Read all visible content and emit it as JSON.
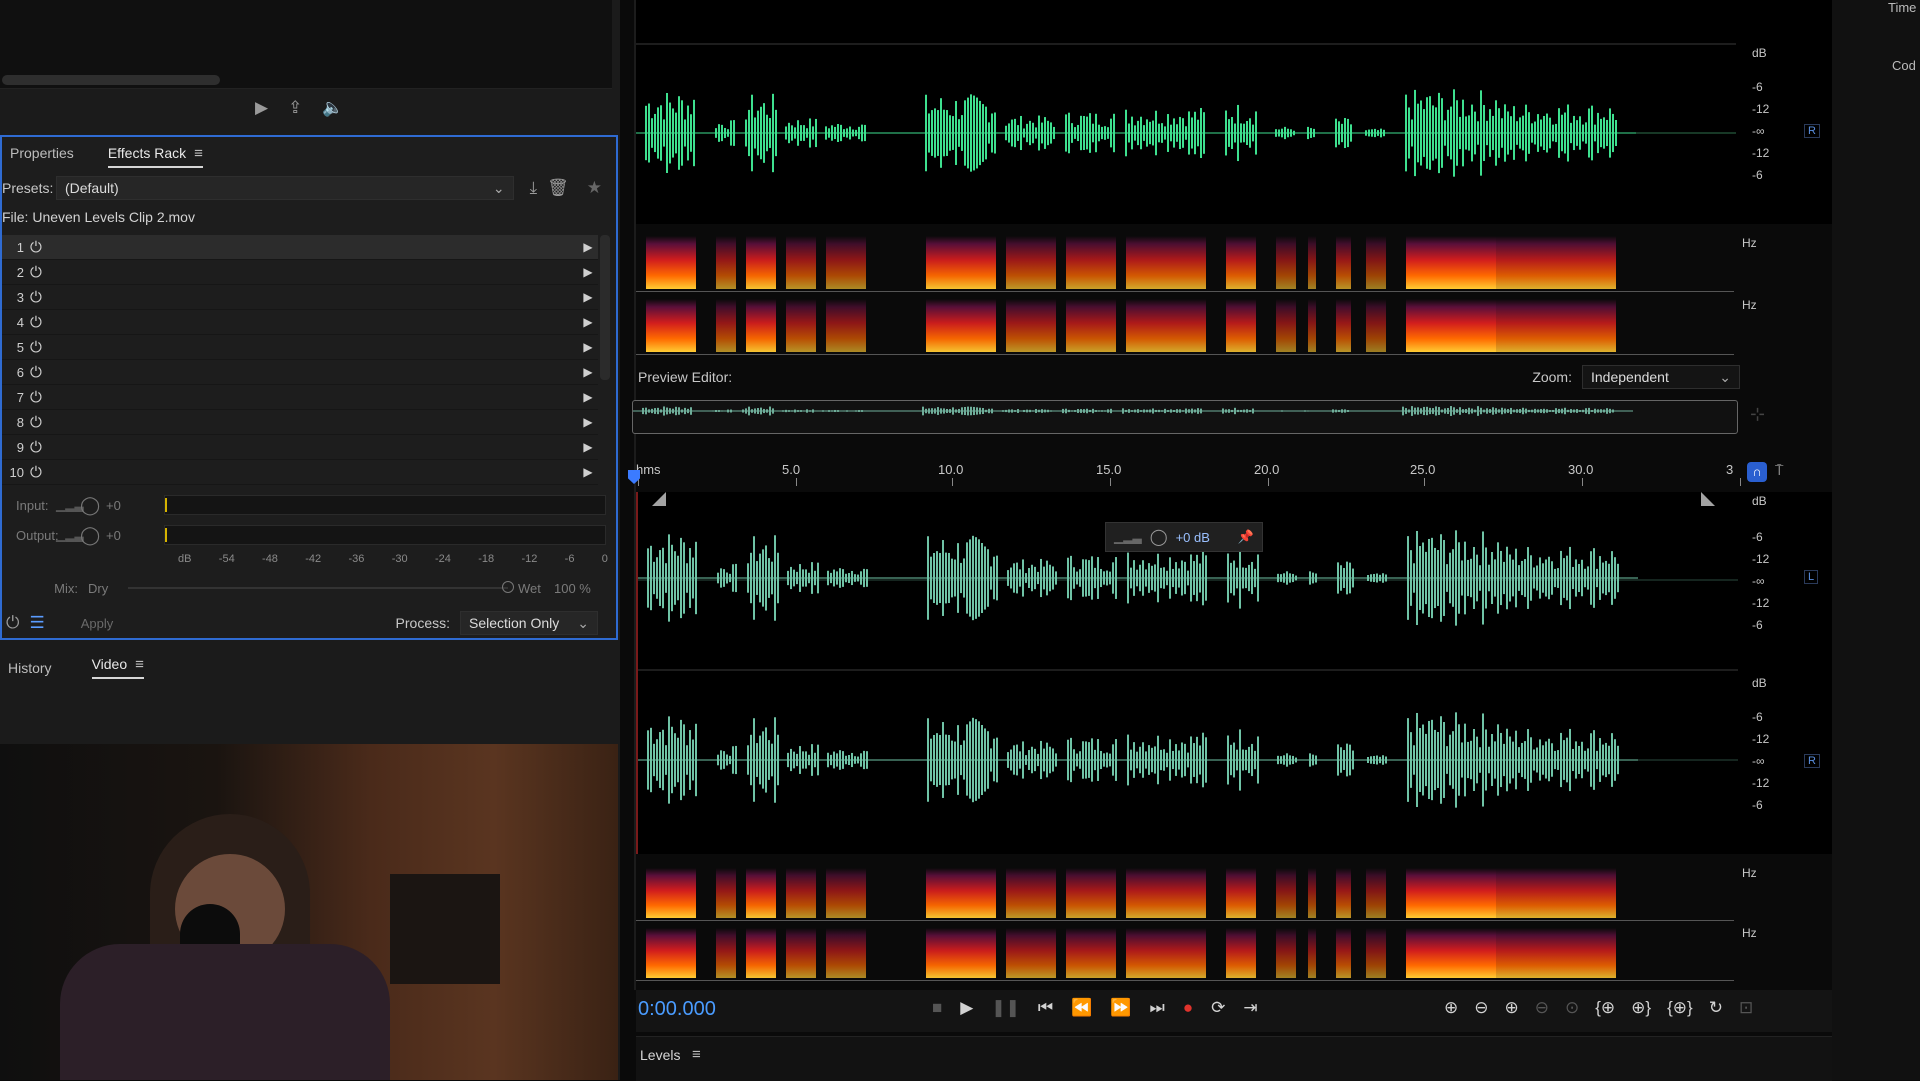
{
  "top_transport": {
    "play": "▶",
    "export": "⇪",
    "volume": "🔈"
  },
  "effects_rack": {
    "tabs": [
      {
        "label": "Properties"
      },
      {
        "label": "Effects Rack"
      }
    ],
    "presets_label": "Presets:",
    "preset_value": "(Default)",
    "file_label": "File: Uneven Levels Clip 2.mov",
    "slots": [
      "1",
      "2",
      "3",
      "4",
      "5",
      "6",
      "7",
      "8",
      "9",
      "10"
    ],
    "input_label": "Input:",
    "input_value": "+0",
    "output_label": "Output:",
    "output_value": "+0",
    "db_ticks": [
      "dB",
      "-54",
      "-48",
      "-42",
      "-36",
      "-30",
      "-24",
      "-18",
      "-12",
      "-6",
      "0"
    ],
    "mix_label": "Mix:",
    "dry_label": "Dry",
    "wet_label": "Wet",
    "wet_value": "100 %",
    "apply_label": "Apply",
    "process_label": "Process:",
    "process_value": "Selection Only"
  },
  "lower_tabs": [
    {
      "label": "History"
    },
    {
      "label": "Video"
    }
  ],
  "editor": {
    "top_db": [
      "dB",
      "-6",
      "-12",
      "-∞",
      "-12",
      "-6"
    ],
    "top_channel": "R",
    "hz_labels": [
      "Hz",
      "Hz"
    ],
    "preview_label": "Preview Editor:",
    "zoom_label": "Zoom:",
    "zoom_value": "Independent",
    "ruler": [
      "hms",
      "5.0",
      "10.0",
      "15.0",
      "20.0",
      "25.0",
      "30.0",
      "3"
    ],
    "popup_db": "+0 dB",
    "lower_db_L": [
      "dB",
      "-6",
      "-12",
      "-∞",
      "-12",
      "-6"
    ],
    "lower_db_R": [
      "dB",
      "-6",
      "-12",
      "-∞",
      "-12",
      "-6"
    ],
    "channel_L": "L",
    "channel_R": "R",
    "hz_labels2": [
      "Hz",
      "Hz"
    ],
    "timecode": "0:00.000"
  },
  "transport_icons": [
    "stop-icon",
    "play-icon",
    "pause-icon",
    "goto-start-icon",
    "rewind-icon",
    "fast-forward-icon",
    "goto-end-icon",
    "record-icon",
    "loop-icon",
    "skip-icon"
  ],
  "zoom_icons": [
    "zoom-in-amp-icon",
    "zoom-out-amp-icon",
    "zoom-in-icon",
    "zoom-out-icon",
    "zoom-full-icon",
    "zoom-in-left-icon",
    "zoom-in-right-icon",
    "zoom-sel-icon",
    "zoom-reset-icon",
    "zoom-extra-icon"
  ],
  "levels_label": "Levels",
  "right_edge": {
    "time": "Time",
    "code": "Cod"
  },
  "colors": {
    "wave_top": "#3ee08f",
    "wave_lower": "#6fc3a6",
    "accent": "#2f6bd2",
    "record": "#e0332c",
    "timecode": "#4a9cff"
  }
}
